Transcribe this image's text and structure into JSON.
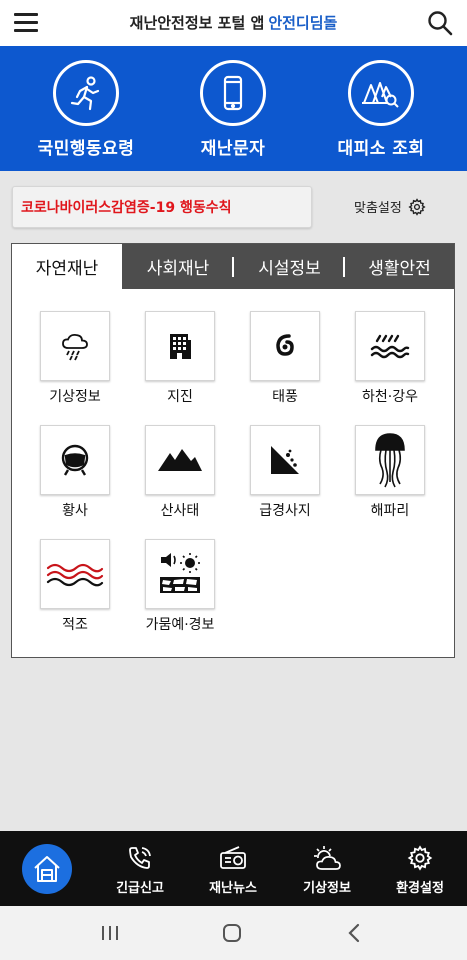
{
  "header": {
    "title": "재난안전정보 포털 앱",
    "brand": "안전디딤돌"
  },
  "quick_menu": [
    {
      "label": "국민행동요령",
      "icon": "running-person-icon"
    },
    {
      "label": "재난문자",
      "icon": "smartphone-icon"
    },
    {
      "label": "대피소 조회",
      "icon": "shelter-search-icon"
    }
  ],
  "notice": {
    "text": "코로나바이러스감염증-19 행동수칙"
  },
  "custom_setting": {
    "label": "맞춤설정",
    "icon": "gear-icon"
  },
  "tabs": [
    {
      "label": "자연재난",
      "active": true
    },
    {
      "label": "사회재난",
      "active": false
    },
    {
      "label": "시설정보",
      "active": false
    },
    {
      "label": "생활안전",
      "active": false
    }
  ],
  "categories": [
    {
      "label": "기상정보",
      "icon": "rain-cloud-icon"
    },
    {
      "label": "지진",
      "icon": "building-icon"
    },
    {
      "label": "태풍",
      "icon": "typhoon-icon"
    },
    {
      "label": "하천·강우",
      "icon": "river-icon"
    },
    {
      "label": "황사",
      "icon": "mask-icon"
    },
    {
      "label": "산사태",
      "icon": "mountain-icon"
    },
    {
      "label": "급경사지",
      "icon": "slope-icon"
    },
    {
      "label": "해파리",
      "icon": "jellyfish-icon"
    },
    {
      "label": "적조",
      "icon": "red-tide-icon"
    },
    {
      "label": "가뭄예·경보",
      "icon": "drought-icon"
    }
  ],
  "bottom_nav": [
    {
      "label": "긴급신고",
      "icon": "phone-call-icon"
    },
    {
      "label": "재난뉴스",
      "icon": "radio-icon"
    },
    {
      "label": "기상정보",
      "icon": "sun-cloud-icon"
    },
    {
      "label": "환경설정",
      "icon": "gear-icon"
    }
  ],
  "colors": {
    "primary": "#0d58cf",
    "notice_red": "#e0161c",
    "nav_bg": "#101010",
    "home": "#1c6fe0"
  }
}
